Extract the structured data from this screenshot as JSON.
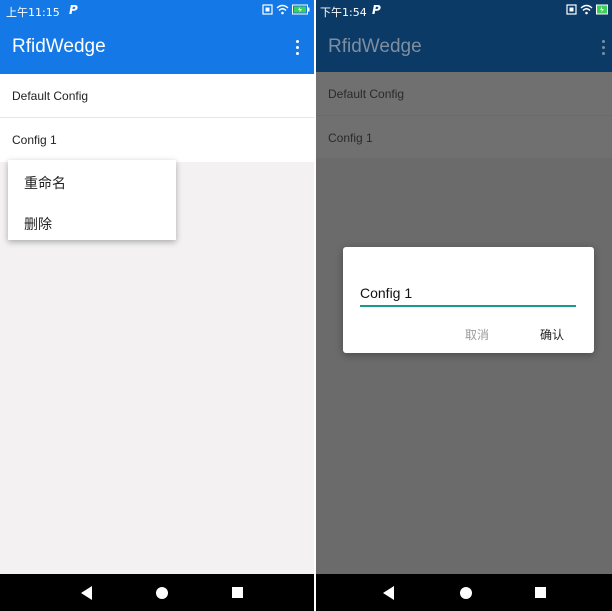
{
  "left": {
    "status": {
      "time": "上午11:15",
      "carrier_icon": "P"
    },
    "app_title": "RfidWedge",
    "list": [
      {
        "label": "Default Config"
      },
      {
        "label": "Config 1"
      }
    ],
    "context_menu": [
      {
        "label": "重命名"
      },
      {
        "label": "删除"
      }
    ],
    "colors": {
      "appbar": "#1479e6",
      "status": "#1479e6"
    }
  },
  "right": {
    "status": {
      "time": "下午1:54",
      "carrier_icon": "P"
    },
    "app_title": "RfidWedge",
    "list": [
      {
        "label": "Default Config"
      },
      {
        "label": "Config 1"
      }
    ],
    "dialog": {
      "value": "Config 1",
      "cancel_label": "取消",
      "ok_label": "确认"
    },
    "colors": {
      "appbar": "#0b3a66",
      "accent": "#1a9a8c"
    }
  }
}
